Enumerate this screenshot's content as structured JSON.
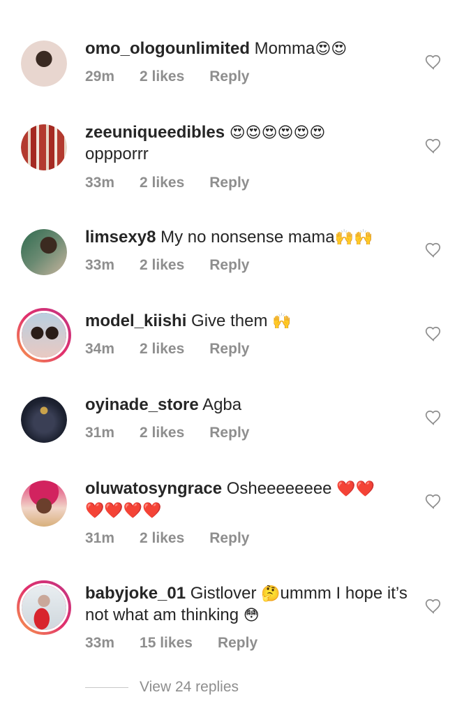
{
  "comments": [
    {
      "username": "omo_ologounlimited",
      "text": " Momma",
      "emoji": "😍😍",
      "text2": "",
      "time": "29m",
      "likes": "2 likes",
      "reply": "Reply"
    },
    {
      "username": "zeeuniqueedibles",
      "text": " ",
      "emoji": "😍😍😍😍😍😍",
      "text2": "oppporrr",
      "time": "33m",
      "likes": "2 likes",
      "reply": "Reply"
    },
    {
      "username": "limsexy8",
      "text": " My no nonsense mama",
      "emoji": "🙌🙌",
      "text2": "",
      "time": "33m",
      "likes": "2 likes",
      "reply": "Reply"
    },
    {
      "username": "model_kiishi",
      "text": " Give them ",
      "emoji": "🙌",
      "text2": "",
      "time": "34m",
      "likes": "2 likes",
      "reply": "Reply"
    },
    {
      "username": "oyinade_store",
      "text": " Agba",
      "emoji": "",
      "text2": "",
      "time": "31m",
      "likes": "2 likes",
      "reply": "Reply"
    },
    {
      "username": "oluwatosyngrace",
      "text": " Osheeeeeeee ",
      "emoji": "❤️❤️",
      "text2": "❤️❤️❤️❤️",
      "time": "31m",
      "likes": "2 likes",
      "reply": "Reply"
    },
    {
      "username": "babyjoke_01",
      "text": " Gistlover ",
      "emoji": "🤔",
      "text_after": "ummm I hope it’s not what am thinking ",
      "emoji2": "😳",
      "time": "33m",
      "likes": "15 likes",
      "reply": "Reply"
    }
  ],
  "view_replies": "View 24 replies",
  "icons": {
    "heart": "heart-outline-icon"
  },
  "colors": {
    "text": "#262626",
    "meta": "#8e8e8e",
    "ring_start": "#f9a24a",
    "ring_end": "#c13584"
  }
}
